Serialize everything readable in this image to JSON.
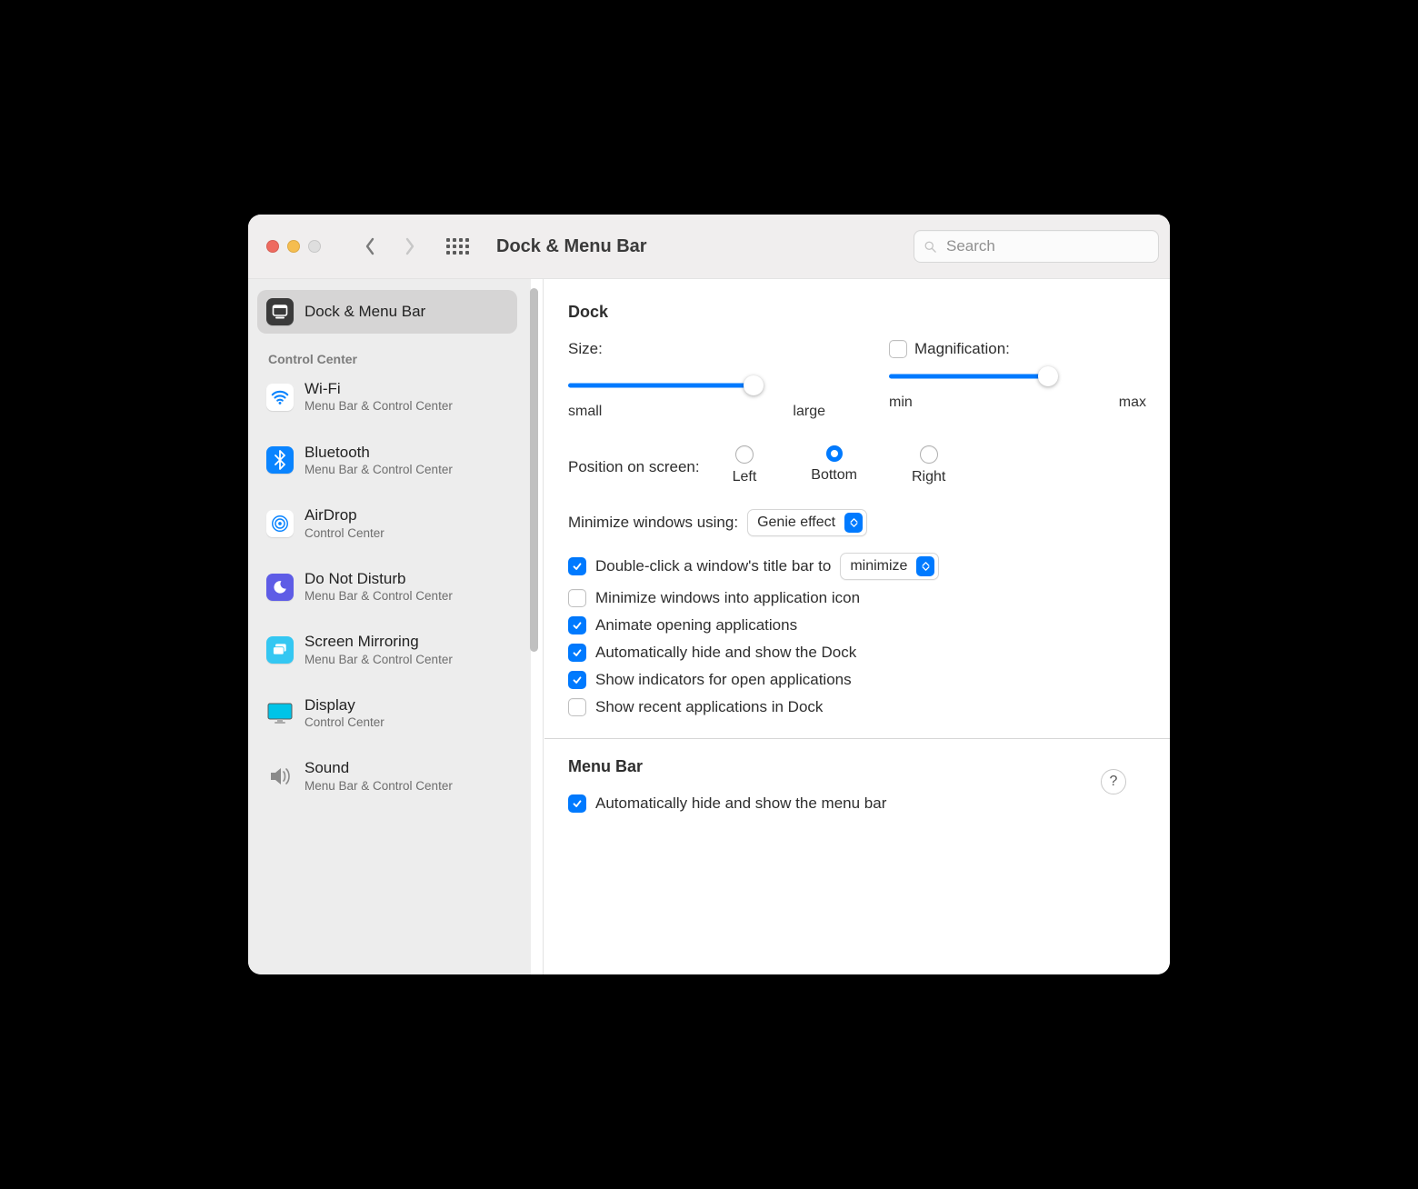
{
  "toolbar": {
    "title": "Dock & Menu Bar",
    "search_placeholder": "Search"
  },
  "sidebar": {
    "top_item": {
      "name": "Dock & Menu Bar"
    },
    "section_header": "Control Center",
    "items": [
      {
        "id": "wifi",
        "name": "Wi-Fi",
        "sub": "Menu Bar & Control Center",
        "icon": "wifi-icon",
        "bg": "#ffffff",
        "fg": "#0a84ff"
      },
      {
        "id": "bluetooth",
        "name": "Bluetooth",
        "sub": "Menu Bar & Control Center",
        "icon": "bluetooth-icon",
        "bg": "#0a84ff",
        "fg": "#ffffff"
      },
      {
        "id": "airdrop",
        "name": "AirDrop",
        "sub": "Control Center",
        "icon": "airdrop-icon",
        "bg": "#ffffff",
        "fg": "#0a84ff"
      },
      {
        "id": "dnd",
        "name": "Do Not Disturb",
        "sub": "Menu Bar & Control Center",
        "icon": "moon-icon",
        "bg": "#5e5ce6",
        "fg": "#ffffff"
      },
      {
        "id": "mirror",
        "name": "Screen Mirroring",
        "sub": "Menu Bar & Control Center",
        "icon": "screens-icon",
        "bg": "#34c7f2",
        "fg": "#ffffff"
      },
      {
        "id": "display",
        "name": "Display",
        "sub": "Control Center",
        "icon": "display-icon",
        "bg": "transparent",
        "fg": "#00b7e5"
      },
      {
        "id": "sound",
        "name": "Sound",
        "sub": "Menu Bar & Control Center",
        "icon": "speaker-icon",
        "bg": "transparent",
        "fg": "#808080"
      }
    ]
  },
  "dock": {
    "section_title": "Dock",
    "size_label": "Size:",
    "size_small": "small",
    "size_large": "large",
    "size_value": 72,
    "mag_label": "Magnification:",
    "mag_checked": false,
    "mag_min": "min",
    "mag_max": "max",
    "mag_value": 62,
    "position_label": "Position on screen:",
    "position_options": [
      "Left",
      "Bottom",
      "Right"
    ],
    "position_selected": "Bottom",
    "minimize_label": "Minimize windows using:",
    "minimize_value": "Genie effect",
    "dblclick_checked": true,
    "dblclick_label": "Double-click a window's title bar to",
    "dblclick_value": "minimize",
    "min_into_app_checked": false,
    "min_into_app_label": "Minimize windows into application icon",
    "animate_checked": true,
    "animate_label": "Animate opening applications",
    "autohide_checked": true,
    "autohide_label": "Automatically hide and show the Dock",
    "indicators_checked": true,
    "indicators_label": "Show indicators for open applications",
    "recent_checked": false,
    "recent_label": "Show recent applications in Dock"
  },
  "menubar": {
    "section_title": "Menu Bar",
    "autohide_checked": true,
    "autohide_label": "Automatically hide and show the menu bar",
    "help": "?"
  }
}
